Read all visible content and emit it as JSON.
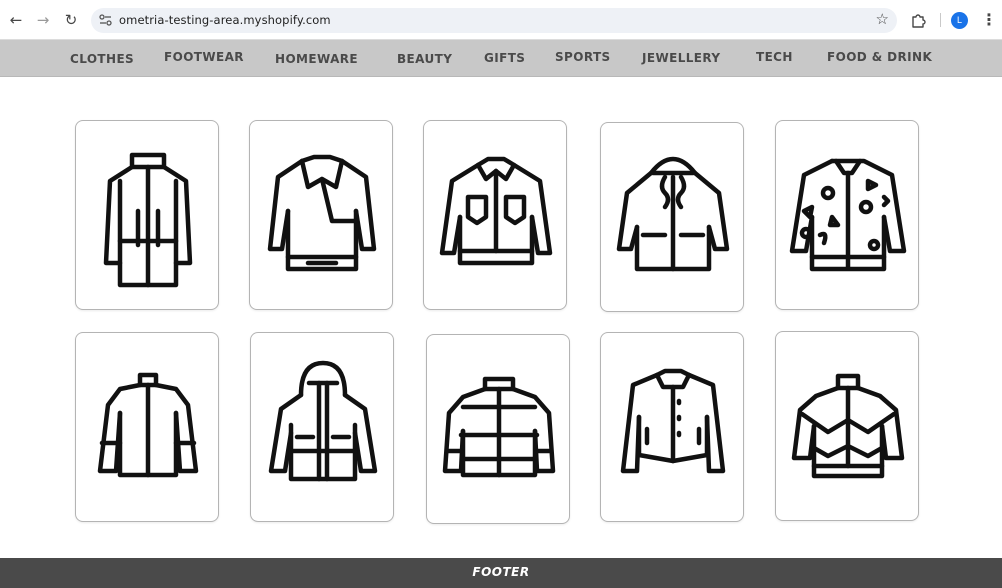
{
  "browser": {
    "url": "ometria-testing-area.myshopify.com",
    "back_icon": "arrow-left",
    "forward_icon": "arrow-right",
    "reload_icon": "reload",
    "bookmark_icon": "star",
    "profile_initial": "L",
    "profile_color": "#1a73e8"
  },
  "nav": {
    "background": "#c8c8c8",
    "items": [
      "CLOTHES",
      "FOOTWEAR",
      "HOMEWARE",
      "BEAUTY",
      "GIFTS",
      "SPORTS",
      "JEWELLERY",
      "TECH",
      "FOOD & DRINK"
    ]
  },
  "products": [
    {
      "icon": "long-coat-icon"
    },
    {
      "icon": "biker-jacket-icon"
    },
    {
      "icon": "denim-jacket-icon"
    },
    {
      "icon": "hooded-parka-icon"
    },
    {
      "icon": "patterned-bomber-icon"
    },
    {
      "icon": "zip-jacket-icon"
    },
    {
      "icon": "hooded-puffer-icon"
    },
    {
      "icon": "puffer-jacket-icon"
    },
    {
      "icon": "button-jacket-icon"
    },
    {
      "icon": "track-jacket-icon"
    }
  ],
  "footer": {
    "label": "FOOTER",
    "background": "#4a4a4a"
  }
}
